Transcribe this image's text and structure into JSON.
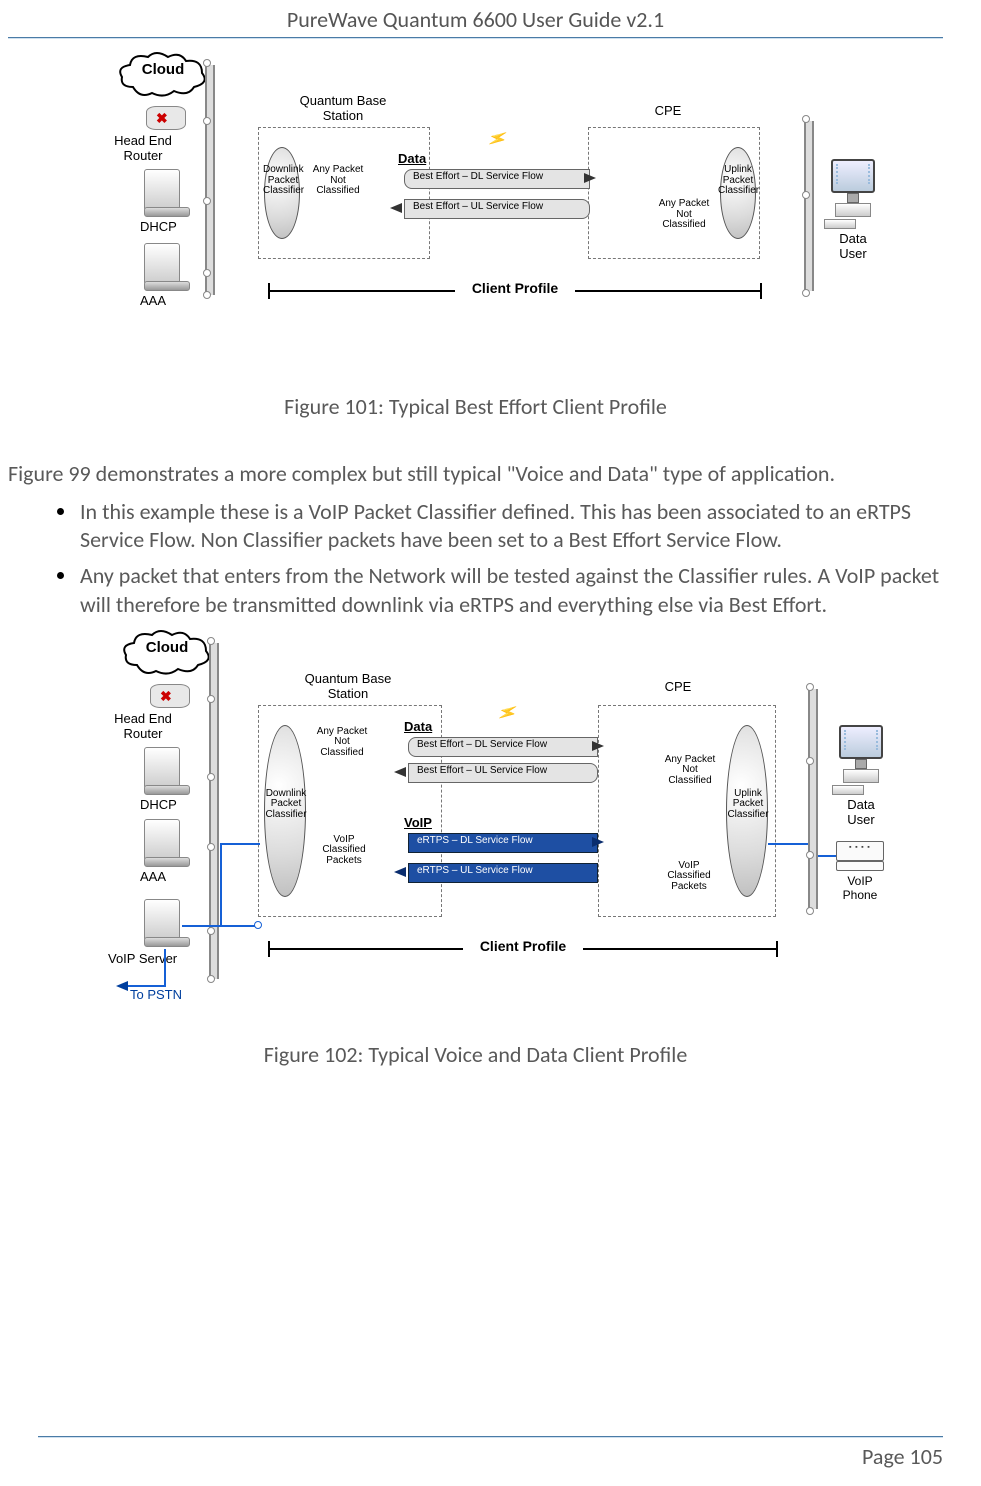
{
  "header": {
    "title": "PureWave Quantum 6600 User Guide v2.1"
  },
  "fig1": {
    "caption": "Figure 101: Typical Best Effort Client Profile",
    "labels": {
      "cloud": "Cloud",
      "head_end_router": "Head End\nRouter",
      "dhcp": "DHCP",
      "aaa": "AAA",
      "quantum": "Quantum Base\nStation",
      "cpe": "CPE",
      "data_hdr": "Data",
      "dl_classifier": "Downlink\nPacket\nClassifier",
      "ul_classifier": "Uplink\nPacket\nClassifier",
      "any_packet": "Any Packet\nNot Classified",
      "flow_be_dl": "Best Effort – DL Service Flow",
      "flow_be_ul": "Best Effort – UL Service Flow",
      "client_profile": "Client Profile",
      "data_user": "Data\nUser"
    }
  },
  "body": {
    "intro": "Figure 99 demonstrates a more complex but still typical \"Voice and Data\" type of application.",
    "bullets": [
      "In this example these is a VoIP Packet Classifier defined. This has been associated to an eRTPS Service Flow. Non Classifier packets have been set to a Best Effort Service Flow.",
      "Any packet that enters from the Network will be tested against the Classifier rules. A VoIP packet will therefore be transmitted downlink via eRTPS and everything else via Best Effort."
    ]
  },
  "fig2": {
    "caption": "Figure 102: Typical Voice and Data Client Profile",
    "labels": {
      "cloud": "Cloud",
      "head_end_router": "Head End\nRouter",
      "dhcp": "DHCP",
      "aaa": "AAA",
      "voip_server": "VoIP Server",
      "to_pstn": "To PSTN",
      "quantum": "Quantum Base\nStation",
      "cpe": "CPE",
      "data_hdr": "Data",
      "voip_hdr": "VoIP",
      "dl_classifier": "Downlink\nPacket\nClassifier",
      "ul_classifier": "Uplink\nPacket\nClassifier",
      "any_packet": "Any Packet\nNot Classified",
      "voip_classified": "VoIP Classified\nPackets",
      "flow_be_dl": "Best Effort – DL Service Flow",
      "flow_be_ul": "Best Effort – UL Service Flow",
      "flow_ertps_dl": "eRTPS – DL Service Flow",
      "flow_ertps_ul": "eRTPS – UL Service Flow",
      "client_profile": "Client Profile",
      "data_user": "Data\nUser",
      "voip_phone": "VoIP\nPhone"
    }
  },
  "footer": {
    "page": "Page 105"
  }
}
